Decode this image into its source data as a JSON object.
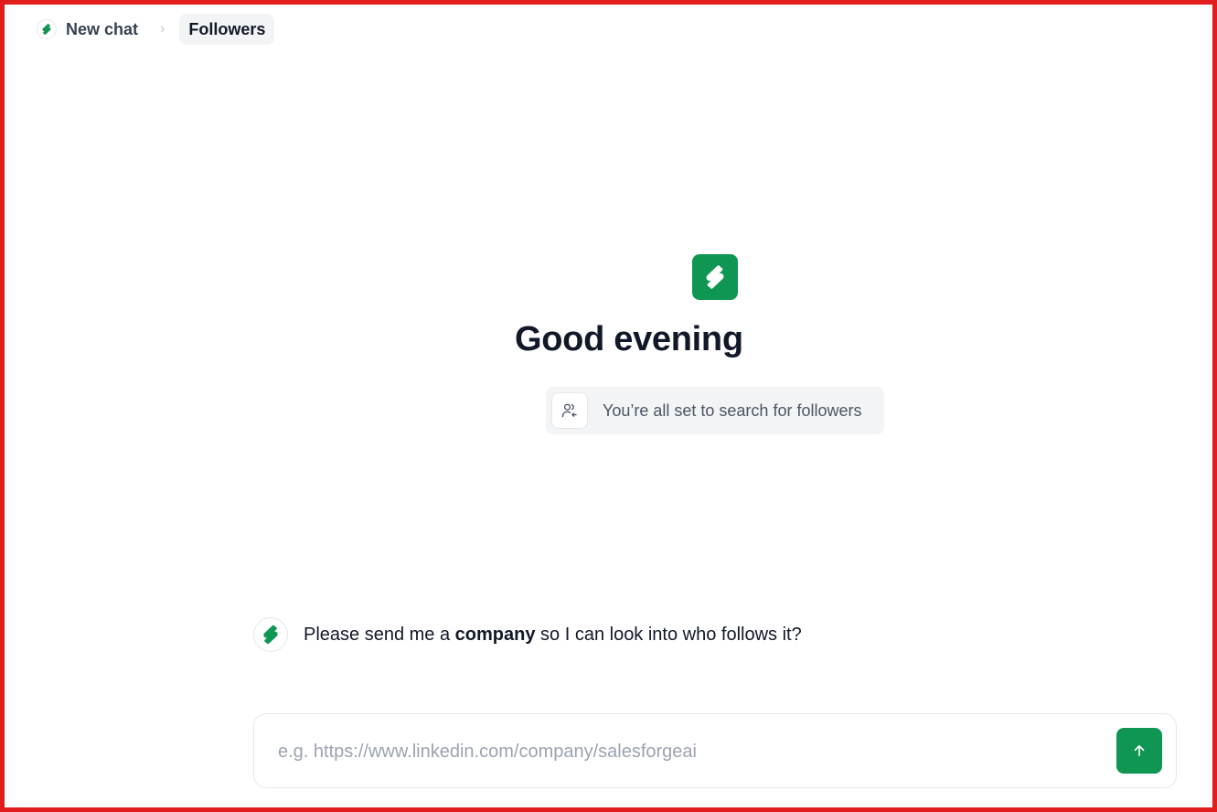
{
  "breadcrumb": {
    "home_label": "New chat",
    "separator": "›",
    "current_label": "Followers"
  },
  "hero": {
    "greeting": "Good evening",
    "status_text": "You’re all set to search for followers"
  },
  "message": {
    "text_before": "Please send me a ",
    "text_bold": "company",
    "text_after": " so I can look into who follows it?"
  },
  "composer": {
    "placeholder": "e.g. https://www.linkedin.com/company/salesforgeai",
    "value": ""
  },
  "icons": {
    "brand": "brand-logo-icon",
    "status": "user-follow-icon",
    "send": "arrow-up-icon"
  },
  "colors": {
    "brand_green": "#0f9652",
    "frame_red": "#e11d1d"
  }
}
